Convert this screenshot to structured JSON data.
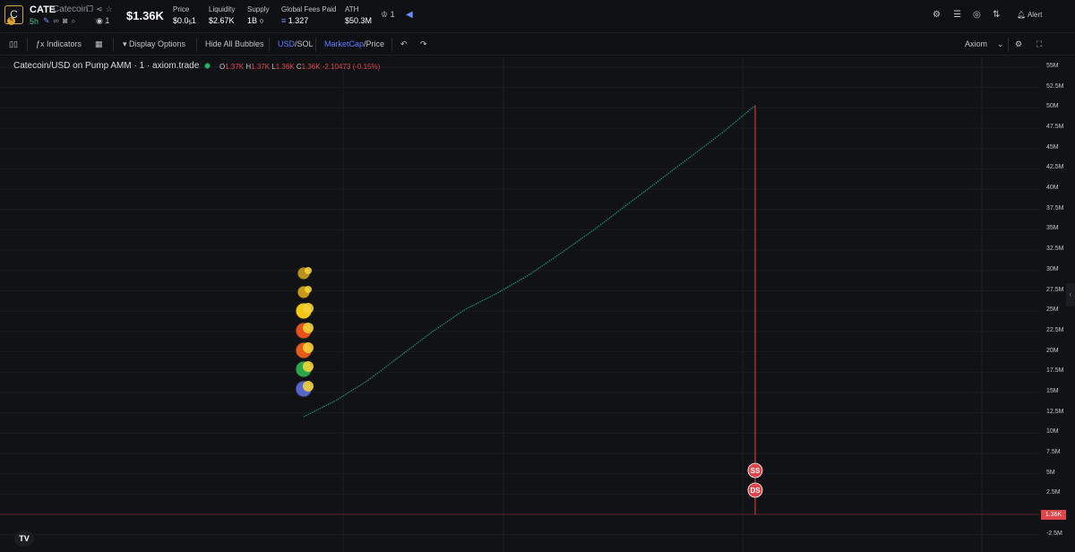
{
  "header": {
    "logo_letter": "C",
    "ticker": "CATE",
    "name": "Catecoin",
    "age": "5h",
    "watchers": "1",
    "market_cap": "$1.36K",
    "stats": [
      {
        "label": "Price",
        "value": "$0.0",
        "sub": "5",
        "tail": "1"
      },
      {
        "label": "Liquidity",
        "value": "$2.67K"
      },
      {
        "label": "Supply",
        "value": "1B"
      },
      {
        "label": "Global Fees Paid",
        "value": "1.327"
      },
      {
        "label": "ATH",
        "value": "$50.3M"
      }
    ],
    "crown_count": "1",
    "alert_label": "Alert"
  },
  "toolbar": {
    "indicators_label": "Indicators",
    "display_options_label": "Display Options",
    "hide_bubbles_label": "Hide All Bubbles",
    "usd_label": "USD",
    "sol_label": "SOL",
    "marketcap_label": "MarketCap",
    "price_label": "Price",
    "source_label": "Axiom"
  },
  "chart": {
    "legend": "Catecoin/USD on Pump AMM · 1 · axiom.trade",
    "ohlc": {
      "o": "1.37K",
      "h": "1.37K",
      "l": "1.36K",
      "c": "1.36K",
      "change": "-2.10473 (-0.15%)"
    },
    "current_price_tag": "1.36K",
    "marker_labels": [
      "SS",
      "DS"
    ]
  },
  "colors": {
    "accent_blue": "#5b7cff",
    "up_green": "#2fb36b",
    "down_red": "#e0454a",
    "line_green": "#1f8f6a"
  },
  "chart_data": {
    "type": "line",
    "y_ticks": [
      "55M",
      "52.5M",
      "50M",
      "47.5M",
      "45M",
      "42.5M",
      "40M",
      "37.5M",
      "35M",
      "32.5M",
      "30M",
      "27.5M",
      "25M",
      "22.5M",
      "20M",
      "17.5M",
      "15M",
      "12.5M",
      "10M",
      "7.5M",
      "5M",
      "2.5M",
      "-2.5M"
    ],
    "ylim": [
      -2500000,
      55000000
    ],
    "series": [
      {
        "values": [
          12000000,
          14000000,
          16500000,
          19500000,
          22500000,
          25200000,
          27200000,
          29500000,
          32200000,
          35000000,
          38000000,
          41000000,
          44000000,
          47000000,
          50300000,
          1360
        ]
      }
    ]
  }
}
